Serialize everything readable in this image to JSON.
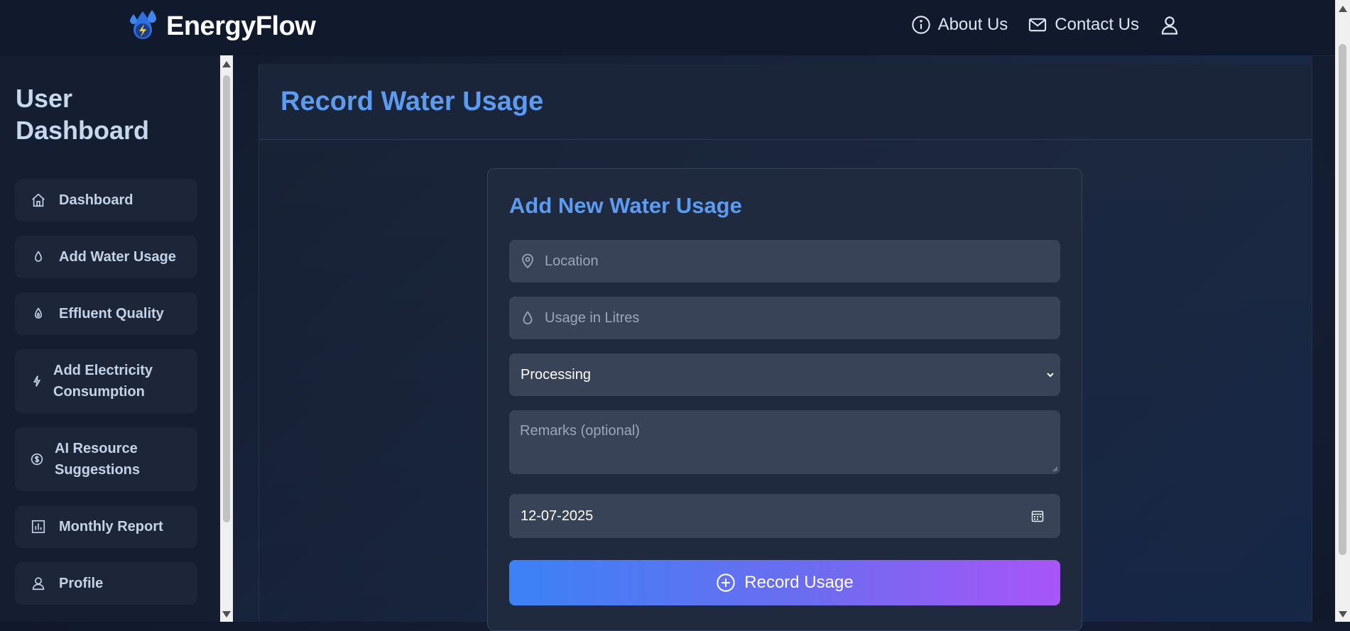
{
  "header": {
    "brand_name": "EnergyFlow",
    "nav": {
      "about_label": "About Us",
      "contact_label": "Contact Us"
    }
  },
  "sidebar": {
    "title": "User Dashboard",
    "items": [
      {
        "label": "Dashboard",
        "icon": "home-icon"
      },
      {
        "label": "Add Water Usage",
        "icon": "droplet-icon"
      },
      {
        "label": "Effluent Quality",
        "icon": "flame-droplet-icon"
      },
      {
        "label": "Add Electricity Consumption",
        "icon": "lightning-icon"
      },
      {
        "label": "AI Resource Suggestions",
        "icon": "dollar-circle-icon"
      },
      {
        "label": "Monthly Report",
        "icon": "bar-chart-icon"
      },
      {
        "label": "Profile",
        "icon": "user-icon"
      }
    ]
  },
  "main": {
    "page_title": "Record Water Usage",
    "form": {
      "title": "Add New Water Usage",
      "location_placeholder": "Location",
      "usage_placeholder": "Usage in Litres",
      "category_selected": "Processing",
      "remarks_placeholder": "Remarks (optional)",
      "date_value": "12-07-2025",
      "submit_label": "Record Usage"
    }
  },
  "colors": {
    "accent": "#5b9cf2",
    "gradient_start": "#3b82f6",
    "gradient_end": "#a855f7",
    "background": "#141d33"
  }
}
